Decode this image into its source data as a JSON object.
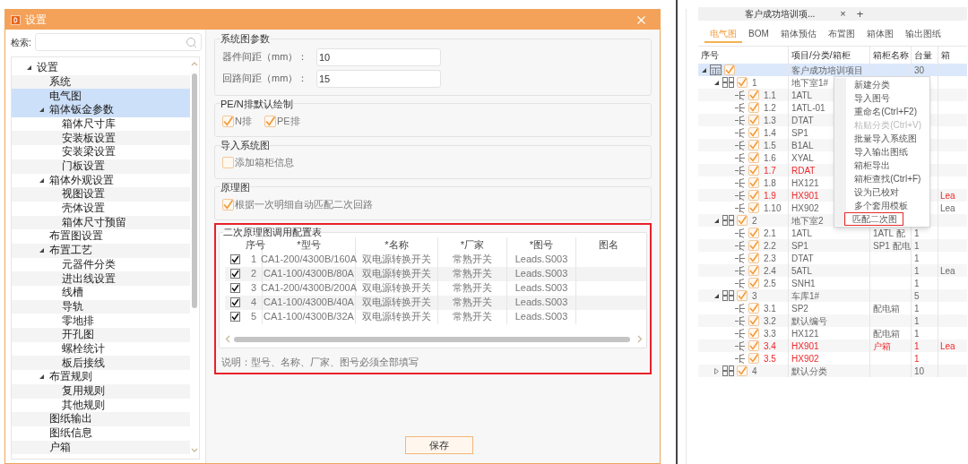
{
  "dialog": {
    "title": "设置",
    "search_label": "检索:",
    "tree": [
      {
        "label": "设置",
        "selected": false,
        "expanded": true,
        "children": [
          {
            "label": "系统",
            "selected": false
          },
          {
            "label": "电气图",
            "selected": true
          },
          {
            "label": "箱体钣金参数",
            "selected": true,
            "expanded": true,
            "children": [
              {
                "label": "箱体尺寸库",
                "selected": false
              },
              {
                "label": "安装板设置",
                "selected": false
              },
              {
                "label": "安装梁设置",
                "selected": false
              },
              {
                "label": "门板设置",
                "selected": false
              }
            ]
          },
          {
            "label": "箱体外观设置",
            "selected": false,
            "expanded": true,
            "children": [
              {
                "label": "视图设置",
                "selected": false
              },
              {
                "label": "壳体设置",
                "selected": false
              },
              {
                "label": "箱体尺寸预留",
                "selected": false
              }
            ]
          },
          {
            "label": "布置图设置",
            "selected": false
          },
          {
            "label": "布置工艺",
            "selected": false,
            "expanded": true,
            "children": [
              {
                "label": "元器件分类",
                "selected": false
              },
              {
                "label": "进出线设置",
                "selected": false
              },
              {
                "label": "线槽",
                "selected": false
              },
              {
                "label": "导轨",
                "selected": false
              },
              {
                "label": "零地排",
                "selected": false
              },
              {
                "label": "开孔图",
                "selected": false
              },
              {
                "label": "螺栓统计",
                "selected": false
              },
              {
                "label": "板后接线",
                "selected": false
              }
            ]
          },
          {
            "label": "布置规则",
            "selected": false,
            "expanded": true,
            "children": [
              {
                "label": "复用规则",
                "selected": false
              },
              {
                "label": "其他规则",
                "selected": false
              }
            ]
          },
          {
            "label": "图纸输出",
            "selected": false
          },
          {
            "label": "图纸信息",
            "selected": false
          },
          {
            "label": "户箱",
            "selected": false
          }
        ]
      }
    ],
    "system_params": {
      "title": "系统图参数",
      "fields": [
        {
          "label": "器件间距（mm）：",
          "value": "10"
        },
        {
          "label": "回路间距（mm）：",
          "value": "15"
        }
      ]
    },
    "pe_n": {
      "title": "PE/N排默认绘制",
      "options": [
        {
          "label": "N排",
          "checked": true
        },
        {
          "label": "PE排",
          "checked": true
        }
      ]
    },
    "import": {
      "title": "导入系统图",
      "options": [
        {
          "label": "添加箱柜信息",
          "checked": false
        }
      ]
    },
    "schematic": {
      "title": "原理图",
      "options": [
        {
          "label": "根据一次明细自动匹配二次回路",
          "checked": true
        }
      ]
    },
    "config_table": {
      "title": "二次原理图调用配置表",
      "columns": [
        "序号",
        "*型号",
        "*名称",
        "*厂家",
        "*图号",
        "图名"
      ],
      "rows": [
        {
          "checked": true,
          "cells": [
            "1",
            "CA1-200/4300B/160A",
            "双电源转换开关",
            "常熟开关",
            "Leads.S003"
          ]
        },
        {
          "checked": true,
          "cells": [
            "2",
            "CA1-100/4300B/80A",
            "双电源转换开关",
            "常熟开关",
            "Leads.S003"
          ]
        },
        {
          "checked": true,
          "cells": [
            "3",
            "CA1-200/4300B/200A",
            "双电源转换开关",
            "常熟开关",
            "Leads.S003"
          ]
        },
        {
          "checked": true,
          "cells": [
            "4",
            "CA1-100/4300B/40A",
            "双电源转换开关",
            "常熟开关",
            "Leads.S003"
          ]
        },
        {
          "checked": true,
          "cells": [
            "5",
            "CA1-100/4300B/32A",
            "双电源转换开关",
            "常熟开关",
            "Leads.S003"
          ]
        }
      ],
      "note": "说明：型号、名称、厂家、图号必须全部填写"
    },
    "save_button": "保存"
  },
  "project": {
    "tab": "客户成功培训项...",
    "close": "×",
    "add": "+",
    "subtabs": [
      {
        "label": "电气图",
        "selected": true
      },
      {
        "label": "BOM",
        "selected": false
      },
      {
        "label": "箱体预估",
        "selected": false
      },
      {
        "label": "布置图",
        "selected": false
      },
      {
        "label": "箱体图",
        "selected": false
      },
      {
        "label": "输出图纸",
        "selected": false
      }
    ],
    "columns": [
      "序号",
      "项目/分类/箱柜",
      "箱柜名称",
      "台量",
      "箱"
    ],
    "rows": [
      {
        "kind": "project",
        "checked": true,
        "expanded": true,
        "selected": true,
        "warning": false,
        "name": "客户成功培训项目",
        "quantity": "30",
        "children": [
          {
            "kind": "group",
            "checked": true,
            "expanded": true,
            "selected": false,
            "warning": false,
            "number": "1",
            "name": "地下室1#",
            "children": [
              {
                "kind": "cabinet",
                "checked": true,
                "selected": false,
                "warning": false,
                "number": "1.1",
                "name": "1ATL"
              },
              {
                "kind": "cabinet",
                "checked": true,
                "selected": false,
                "warning": false,
                "number": "1.2",
                "name": "1ATL-01"
              },
              {
                "kind": "cabinet",
                "checked": true,
                "selected": false,
                "warning": false,
                "number": "1.3",
                "name": "DTAT"
              },
              {
                "kind": "cabinet",
                "checked": true,
                "selected": false,
                "warning": false,
                "number": "1.4",
                "name": "SP1"
              },
              {
                "kind": "cabinet",
                "checked": true,
                "selected": false,
                "warning": false,
                "number": "1.5",
                "name": "B1AL"
              },
              {
                "kind": "cabinet",
                "checked": true,
                "selected": false,
                "warning": false,
                "number": "1.6",
                "name": "XYAL"
              },
              {
                "kind": "cabinet",
                "checked": true,
                "selected": false,
                "warning": true,
                "number": "1.7",
                "name": "RDAT"
              },
              {
                "kind": "cabinet",
                "checked": true,
                "selected": false,
                "warning": false,
                "number": "1.8",
                "name": "HX121"
              },
              {
                "kind": "cabinet",
                "checked": true,
                "selected": false,
                "warning": true,
                "number": "1.9",
                "name": "HX901",
                "column_5": "Lea"
              },
              {
                "kind": "cabinet",
                "checked": true,
                "selected": false,
                "warning": false,
                "number": "1.10",
                "name": "HX902",
                "column_5": "Lea"
              }
            ]
          },
          {
            "kind": "group",
            "checked": true,
            "expanded": true,
            "selected": false,
            "warning": false,
            "number": "2",
            "name": "地下室2",
            "children": [
              {
                "kind": "cabinet",
                "checked": true,
                "selected": false,
                "warning": false,
                "number": "2.1",
                "name": "1ATL",
                "cabinet_name": "1ATL 配",
                "quantity": "1"
              },
              {
                "kind": "cabinet",
                "checked": true,
                "selected": false,
                "warning": false,
                "number": "2.2",
                "name": "SP1",
                "cabinet_name": "SP1 配电",
                "quantity": "1"
              },
              {
                "kind": "cabinet",
                "checked": true,
                "selected": false,
                "warning": false,
                "number": "2.3",
                "name": "DTAT",
                "quantity": "1"
              },
              {
                "kind": "cabinet",
                "checked": true,
                "selected": false,
                "warning": false,
                "number": "2.4",
                "name": "5ATL",
                "quantity": "1",
                "column_5": "Lea"
              },
              {
                "kind": "cabinet",
                "checked": true,
                "selected": false,
                "warning": false,
                "number": "2.5",
                "name": "SNH1",
                "quantity": "1"
              }
            ]
          },
          {
            "kind": "group",
            "checked": true,
            "expanded": true,
            "selected": false,
            "warning": false,
            "number": "3",
            "name": "车库1#",
            "quantity": "5",
            "children": [
              {
                "kind": "cabinet",
                "checked": true,
                "selected": false,
                "warning": false,
                "number": "3.1",
                "name": "SP2",
                "cabinet_name": "配电箱",
                "quantity": "1"
              },
              {
                "kind": "cabinet",
                "checked": true,
                "selected": false,
                "warning": false,
                "number": "3.2",
                "name": "默认编号",
                "quantity": "1"
              },
              {
                "kind": "cabinet",
                "checked": true,
                "selected": false,
                "warning": false,
                "number": "3.3",
                "name": "HX121",
                "cabinet_name": "配电箱",
                "quantity": "1"
              },
              {
                "kind": "cabinet",
                "checked": true,
                "selected": false,
                "warning": true,
                "number": "3.4",
                "name": "HX901",
                "cabinet_name": "户箱",
                "quantity": "1",
                "column_5": "Lea"
              },
              {
                "kind": "cabinet",
                "checked": true,
                "selected": false,
                "warning": true,
                "number": "3.5",
                "name": "HX902",
                "quantity": "1"
              }
            ]
          },
          {
            "kind": "group",
            "checked": true,
            "expanded": false,
            "selected": false,
            "warning": false,
            "number": "4",
            "name": "默认分类",
            "quantity": "10"
          }
        ]
      }
    ],
    "context_menu": [
      {
        "label": "新建分类",
        "disabled": false,
        "selected": false
      },
      {
        "label": "导入图号",
        "disabled": false,
        "selected": false
      },
      {
        "label": "重命名(Ctrl+F2)",
        "disabled": false,
        "selected": false
      },
      {
        "label": "粘贴分类(Ctrl+V)",
        "disabled": true,
        "selected": false
      },
      {
        "label": "批量导入系统图",
        "disabled": false,
        "selected": false
      },
      {
        "label": "导入输出图纸",
        "disabled": false,
        "selected": false
      },
      {
        "label": "箱柜导出",
        "disabled": false,
        "selected": false
      },
      {
        "label": "箱柜查找(Ctrl+F)",
        "disabled": false,
        "selected": false
      },
      {
        "label": "设为已校对",
        "disabled": false,
        "selected": false
      },
      {
        "label": "多个套用模板",
        "disabled": false,
        "selected": false
      },
      {
        "label": "匹配二次图",
        "disabled": false,
        "selected": true
      }
    ]
  }
}
